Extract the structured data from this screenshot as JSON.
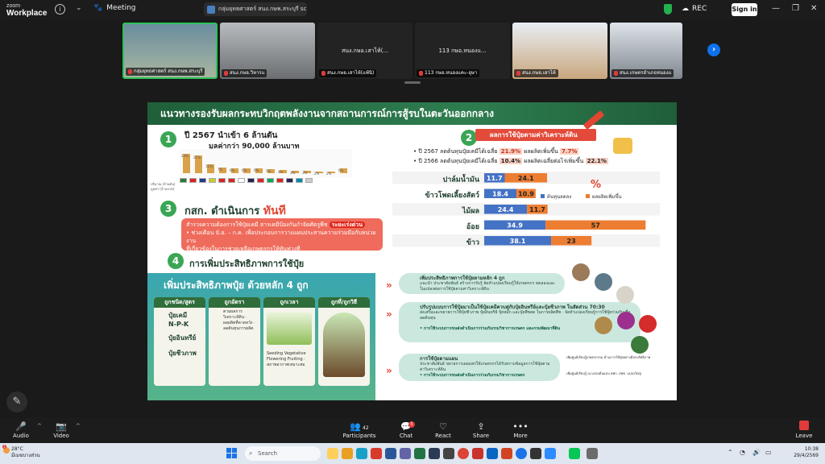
{
  "titlebar": {
    "logo_line1": "zoom",
    "logo_line2": "Workplace",
    "meeting_label": "Meeting",
    "share_label": "กลุ่มยุทธศาสตร์ สนง.กษพ.สระบุรี scre",
    "rec_label": "REC",
    "signin_label": "Sign in"
  },
  "participants": [
    {
      "name": "กลุ่มยุทธศาสตร์ สนง.กษพ.สระบุรี",
      "kind": "video"
    },
    {
      "name": "สนง.กษอ.วิหารแ",
      "kind": "video"
    },
    {
      "name": "สนง.กษอ.เสาไห้(...",
      "kind": "name"
    },
    {
      "name": "113 กษอ.หนองแ...",
      "kind": "name"
    },
    {
      "name": "สนง.กษอ.เสาไห้",
      "kind": "video"
    },
    {
      "name": "สนง.เกษตรอำเภอหนองแ",
      "kind": "video"
    }
  ],
  "name_tags": {
    "t2": "สนง.กษอ.เสาไห้(แพ้นิ)",
    "t3": "113 กษอ.หนองแคะ-อุษา"
  },
  "slide": {
    "title": "แนวทางรองรับผลกระทบวิกฤตพลังงานจากสถานการณ์การสู้รบในตะวันออกกลาง",
    "s1_num": "1",
    "s1_head": "ปี 2567 นำเข้า 6 ล้านตัน",
    "s1_sub": "มูลค่ากว่า 90,000 ล้านบาท",
    "s1_pcts": [
      "23%",
      "21%",
      "11%",
      "7%",
      "6%",
      "6%",
      "6%",
      "5%",
      "4%",
      "3%",
      "3%",
      "2%",
      "2%",
      "6%"
    ],
    "s1_row1": "ปริมาณ (ล้านตัน)",
    "s1_row2": "มูลค่า (ล้านบาท)",
    "s2_num": "2",
    "s2_badge": "ผลการใช้ปุ๋ยตามค่าวิเคราะห์ดิน",
    "s2_b1_pre": "• ปี 2567 ลดต้นทุนปุ๋ยเคมีได้เฉลี่ย ",
    "s2_b1_hl": "21.9%",
    "s2_b1_mid": "  ผลผลิตเพิ่มขึ้น ",
    "s2_b1_hl2": "7.7%",
    "s2_b2_pre": "• ปี 2566 ลดต้นทุนปุ๋ยเคมีได้เฉลี่ย ",
    "s2_b2_hl": "10.4%",
    "s2_b2_mid": " ผลผลิตเฉลี่ยต่อไร่เพิ่มขึ้น ",
    "s2_b2_hl2": "22.1%",
    "s3_num": "3",
    "s3_title_pre": "กสก. ดำเนินการ ",
    "s3_title_now": "ทันที",
    "s3_box_line1": "สำรวจความต้องการใช้ปุ๋ยเคมี สารเคมีป้องกันกำจัดศัตรูพืช ",
    "s3_box_urgent": "ระยะเร่งด่วน",
    "s3_box_line2": "• ช่วงเดือน มิ.ย. – ก.ค. เพื่อประกอบการวางแผนประสานความร่วมมือกับหน่วยงาน",
    "s3_box_line3": "ที่เกี่ยวข้องในการช่วยเหลือเกษตรกรให้ทันท่วงที",
    "s4_num": "4",
    "s4_title": "การเพิ่มประสิทธิภาพการใช้ปุ๋ย",
    "infog_title": "เพิ่มประสิทธิภาพปุ๋ย ด้วยหลัก 4 ถูก",
    "infog_cols": [
      {
        "head": "ถูกชนิด/สูตร",
        "items": [
          "ปุ๋ยเคมี",
          "N-P-K",
          "ปุ๋ยอินทรีย์",
          "ปุ๋ยชีวภาพ"
        ],
        "sub": ""
      },
      {
        "head": "ถูกอัตรา",
        "items": [],
        "sub": "ตามผลการวิเคราะห์ดิน · ผลผลิตที่คาดหวัง · ลดต้นทุนการผลิต"
      },
      {
        "head": "ถูกเวลา",
        "items": [],
        "sub": "Seeding  Vegetative  Flowering  Fruiting · สภาพอากาศเหมาะสม"
      },
      {
        "head": "ถูกที่/ถูกวิธี",
        "items": [],
        "sub": ""
      }
    ],
    "r1_head": "เพิ่มประสิทธิภาพการใช้ปุ๋ยตามหลัก 4 ถูก",
    "r1_body": "แนะนำ ประชาสัมพันธ์ สร้างการรับรู้ จัดทำแปลงเรียนรู้ให้เกษตรกร ทดลองและในแปลงต่อการใช้ปุ๋ยตามค่าวิเคราะห์ดิน",
    "r2_head": "ปรับรูปแบบการใช้ปุ๋ยมาเป็นใช้ปุ๋ยเคมีควบคู่กับปุ๋ยอินทรีย์และปุ๋ยชีวภาพ ในสัดส่วน 70:30",
    "r2_body": "ส่งเสริมและขยายการใช้ปุ๋ยชีวภาพ ปุ๋ยอินทรีย์ ปุ๋ยหมัก และปุ๋ยพืชสด ในการผลิตพืช · จัดทำแปลงเรียนรู้การใช้ปุ๋ยร่วมกันเพื่อลดต้นทุน",
    "r2_foot": "• การใช้ระบบการขนส่งดำเนินการร่วมกับกรมวิชาการเกษตร และกรมพัฒนาที่ดิน",
    "r3_head": "การใช้ปุ๋ยตามแผน",
    "r3_body": "ประชาสัมพันธ์ ขยายการเผยแพร่ให้เกษตรกรได้รับทราบข้อมูลการใช้ปุ๋ยตามค่าวิเคราะห์ดิน",
    "r3_foot": "• การใช้ระบบการขนส่งดำเนินการร่วมกับกรมวิชาการเกษตร",
    "note1": "เพิ่มศูนย์เรียนรู้เกษตรกรรม ด้านการใช้ปุ๋ยอย่างมีประสิทธิภาพ",
    "note2": "เพิ่มศูนย์เรียนรู้ ณ แปลงต้นแบบ ศพก. สพท. แปลงใหญ่"
  },
  "chart_data": {
    "type": "bar",
    "orientation": "horizontal",
    "stacked": true,
    "categories": [
      "ปาล์มน้ำมัน",
      "ข้าวโพดเลี้ยงสัตว์",
      "ไม้ผล",
      "อ้อย",
      "ข้าว"
    ],
    "series": [
      {
        "name": "ต้นทุนลดลง",
        "values": [
          11.7,
          18.4,
          24.4,
          34.9,
          38.1
        ],
        "color": "#4472c4"
      },
      {
        "name": "ผลผลิตเพิ่มขึ้น",
        "values": [
          24.1,
          10.9,
          11.7,
          57,
          23
        ],
        "color": "#ed7d31"
      }
    ],
    "xlim": [
      0,
      100
    ],
    "legend_position": "top-right",
    "unit_label": "%"
  },
  "zoom_toolbar": {
    "audio": "Audio",
    "video": "Video",
    "participants": "Participants",
    "participants_count": "42",
    "chat": "Chat",
    "chat_badge": "5",
    "react": "React",
    "share": "Share",
    "more": "More",
    "leave": "Leave"
  },
  "taskbar": {
    "weather_temp": "28°C",
    "weather_desc": "มีเมฆบางส่วน",
    "weather_badge": "1",
    "search_label": "Search",
    "time": "10:38",
    "date": "29/4/2569"
  }
}
